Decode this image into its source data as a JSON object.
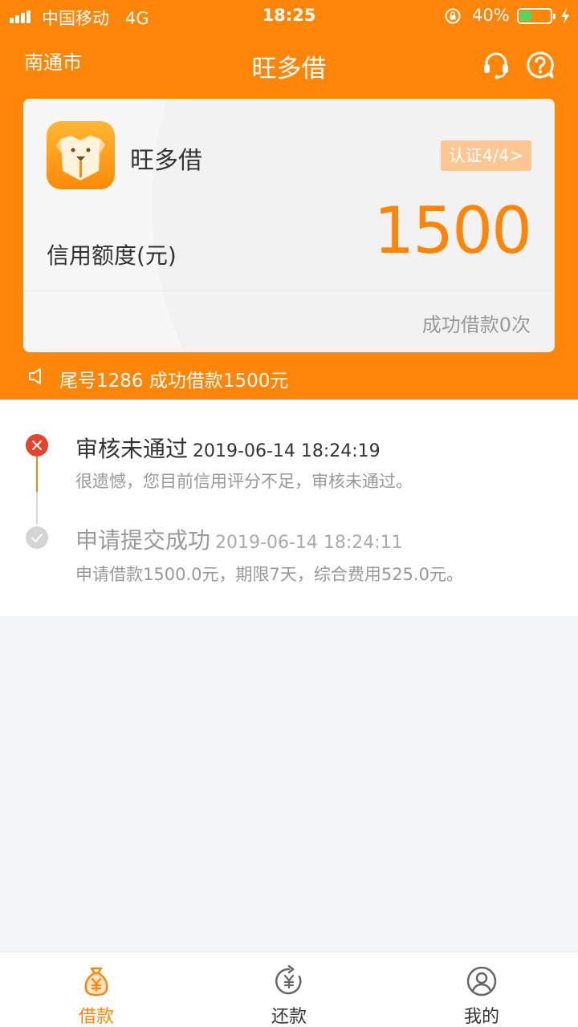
{
  "status_bar": {
    "carrier": "中国移动",
    "network": "4G",
    "time": "18:25",
    "battery_percent": "40%",
    "battery_level": 0.4
  },
  "header": {
    "city": "南通市",
    "title": "旺多借"
  },
  "card": {
    "app_name": "旺多借",
    "cert_badge": "认证4/4>",
    "limit_label": "信用额度(元)",
    "amount": "1500",
    "success_count": "成功借款0次"
  },
  "notice": {
    "text": "尾号1286 成功借款1500元"
  },
  "timeline": {
    "events": [
      {
        "title": "审核未通过",
        "time": "2019-06-14 18:24:19",
        "desc": "很遗憾，您目前信用评分不足，审核未通过。",
        "status": "failed"
      },
      {
        "title": "申请提交成功",
        "time": "2019-06-14 18:24:11",
        "desc": "申请借款1500.0元，期限7天，综合费用525.0元。",
        "status": "done"
      }
    ]
  },
  "tabs": [
    {
      "label": "借款",
      "icon": "money-bag-icon",
      "active": true
    },
    {
      "label": "还款",
      "icon": "repay-icon",
      "active": false
    },
    {
      "label": "我的",
      "icon": "user-icon",
      "active": false
    }
  ],
  "colors": {
    "brand": "#fd8608",
    "fail": "#e8432e",
    "badge": "#fcc793"
  }
}
